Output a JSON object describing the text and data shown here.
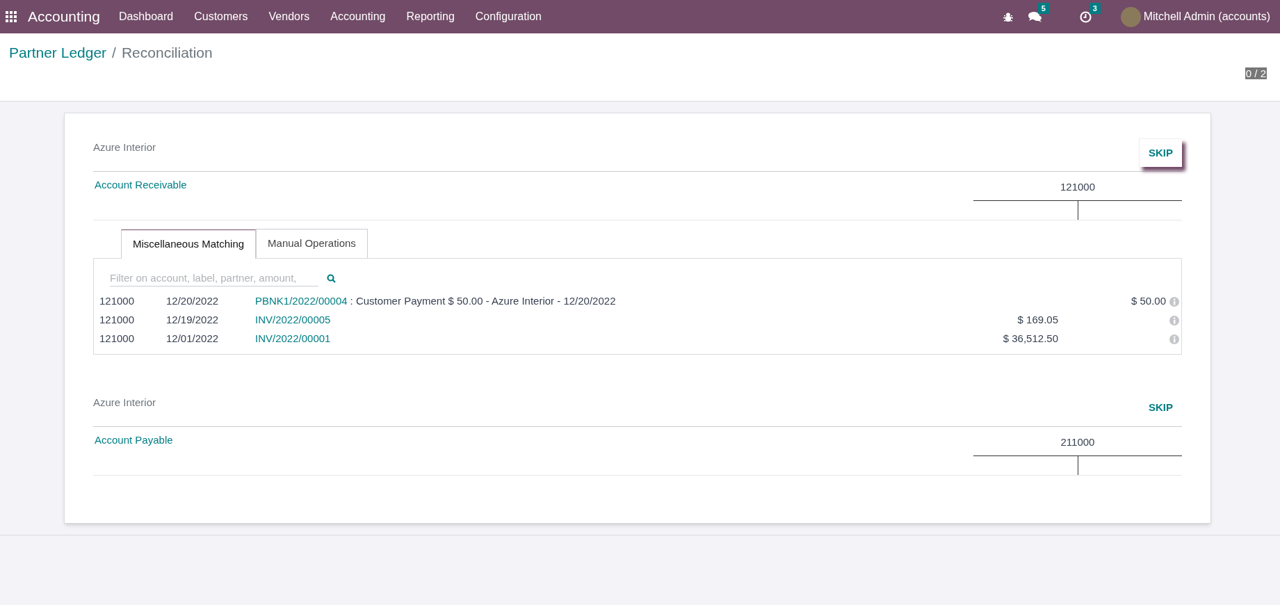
{
  "navbar": {
    "app_name": "Accounting",
    "menu": [
      "Dashboard",
      "Customers",
      "Vendors",
      "Accounting",
      "Reporting",
      "Configuration"
    ],
    "messages_badge": "5",
    "activities_badge": "3",
    "user": "Mitchell Admin (accounts)"
  },
  "breadcrumb": {
    "parent": "Partner Ledger",
    "separator": "/",
    "current": "Reconciliation"
  },
  "pager": "0 / 2",
  "sections": [
    {
      "partner": "Azure Interior",
      "skip": {
        "label": "SKIP",
        "focused": true
      },
      "account_label": "Account Receivable",
      "account_code": "121000",
      "tabs": [
        {
          "label": "Miscellaneous Matching",
          "selected": true
        },
        {
          "label": "Manual Operations",
          "selected": false
        }
      ],
      "filter": {
        "placeholder": "Filter on account, label, partner, amount,"
      },
      "lines": [
        {
          "account": "121000",
          "date": "12/20/2022",
          "reference": "PBNK1/2022/00004",
          "description": ": Customer Payment $ 50.00 - Azure Interior - 12/20/2022",
          "credit": "$ 50.00"
        },
        {
          "account": "121000",
          "date": "12/19/2022",
          "reference": "INV/2022/00005",
          "debit": "$ 169.05"
        },
        {
          "account": "121000",
          "date": "12/01/2022",
          "reference": "INV/2022/00001",
          "debit": "$ 36,512.50"
        }
      ]
    },
    {
      "partner": "Azure Interior",
      "skip": {
        "label": "SKIP",
        "focused": false
      },
      "account_label": "Account Payable",
      "account_code": "211000"
    }
  ]
}
